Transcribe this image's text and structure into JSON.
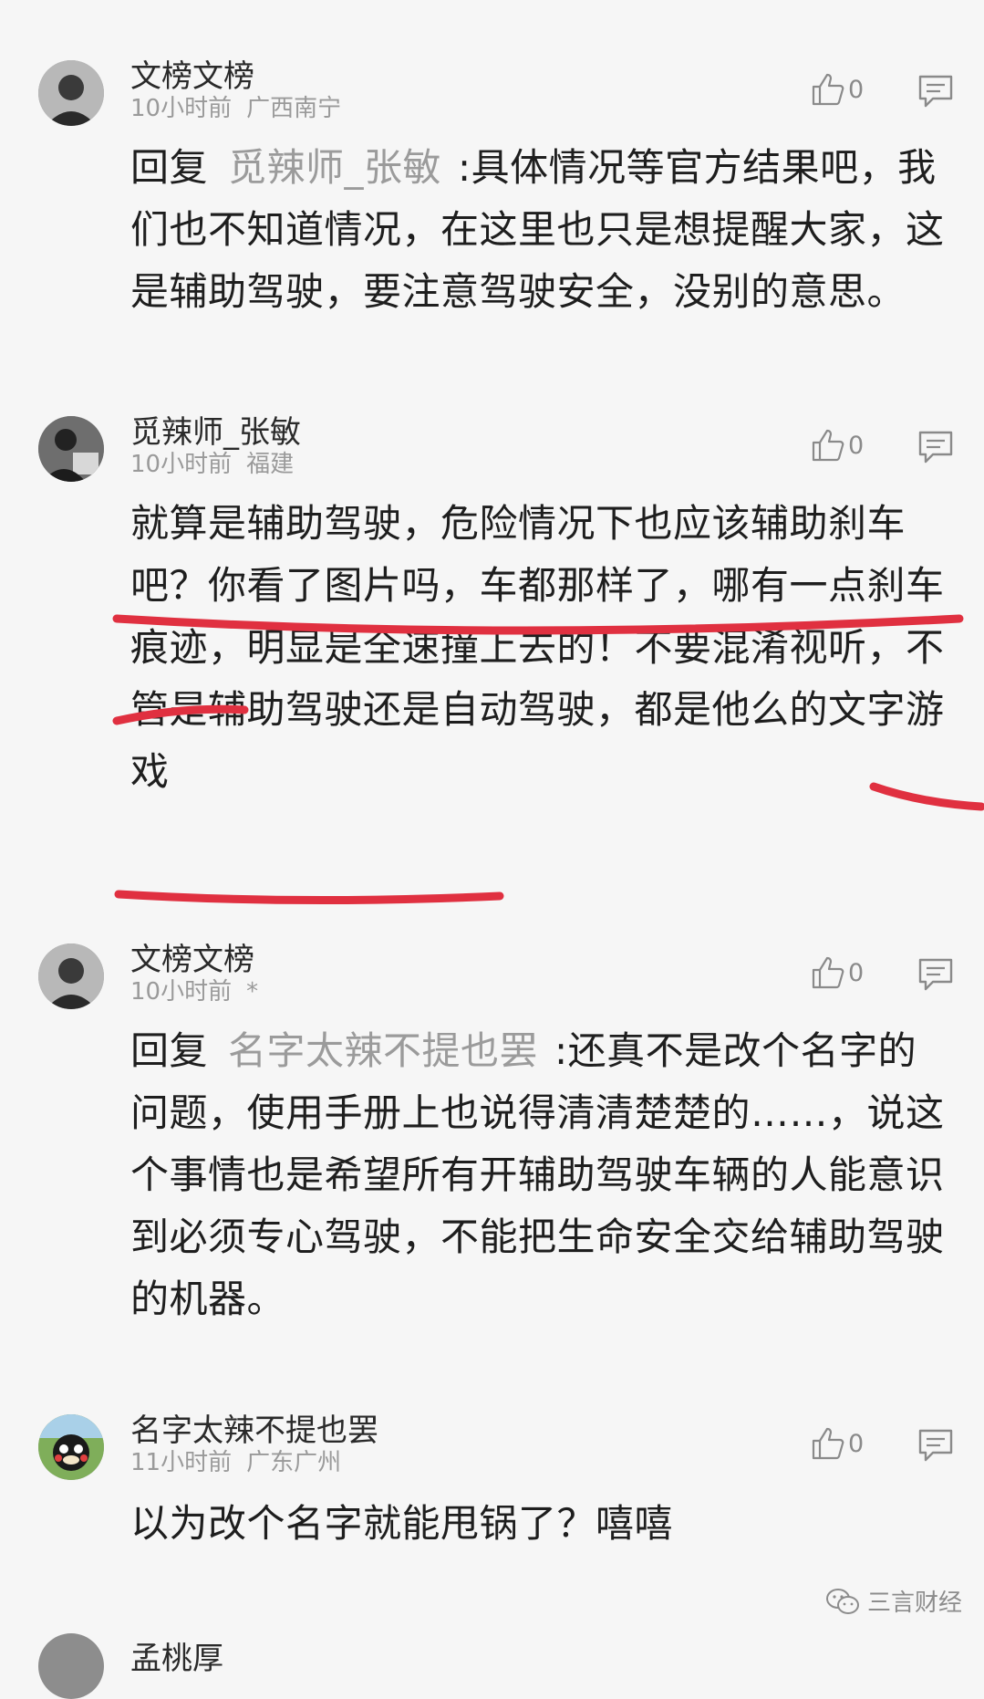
{
  "comments": [
    {
      "username": "文榜文榜",
      "time": "10小时前",
      "location": "广西南宁",
      "likes": "0",
      "reply_prefix": "回复",
      "reply_to": "觅辣师_张敏",
      "text": ":具体情况等官方结果吧，我们也不知道情况，在这里也只是想提醒大家，这是辅助驾驶，要注意驾驶安全，没别的意思。"
    },
    {
      "username": "觅辣师_张敏",
      "time": "10小时前",
      "location": "福建",
      "likes": "0",
      "text": "就算是辅助驾驶，危险情况下也应该辅助刹车吧？你看了图片吗，车都那样了，哪有一点刹车痕迹，明显是全速撞上去的！不要混淆视听，不管是辅助驾驶还是自动驾驶，都是他么的文字游戏"
    },
    {
      "username": "文榜文榜",
      "time": "10小时前",
      "location": "*",
      "likes": "0",
      "reply_prefix": "回复",
      "reply_to": "名字太辣不提也罢",
      "text": ":还真不是改个名字的问题，使用手册上也说得清清楚楚的……，说这个事情也是希望所有开辅助驾驶车辆的人能意识到必须专心驾驶，不能把生命安全交给辅助驾驶的机器。"
    },
    {
      "username": "名字太辣不提也罢",
      "time": "11小时前",
      "location": "广东广州",
      "likes": "0",
      "text": "以为改个名字就能甩锅了？嘻嘻"
    }
  ],
  "peek_username": "孟桃厚",
  "watermark": "三言财经",
  "colors": {
    "highlight_marker": "#e03040",
    "mention": "#9b9b9b",
    "meta": "#9a9a9a"
  },
  "icons": [
    "thumbs-up-icon",
    "reply-bubble-icon",
    "wechat-logo-icon"
  ]
}
